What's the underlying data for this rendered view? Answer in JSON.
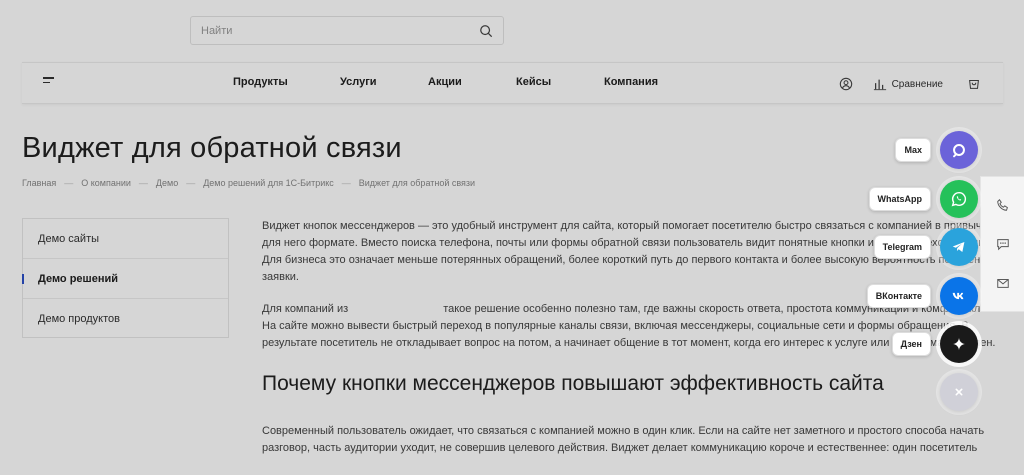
{
  "search": {
    "placeholder": "Найти"
  },
  "nav": {
    "items": [
      "Продукты",
      "Услуги",
      "Акции",
      "Кейсы",
      "Компания"
    ],
    "compare_label": "Сравнение"
  },
  "page": {
    "title": "Виджет для обратной связи",
    "breadcrumb": [
      "Главная",
      "О компании",
      "Демо",
      "Демо решений для 1С-Битрикс",
      "Виджет для обратной связи"
    ]
  },
  "sidemenu": {
    "items": [
      "Демо сайты",
      "Демо решений",
      "Демо продуктов"
    ],
    "active_index": 1
  },
  "article": {
    "p1": "Виджет кнопок мессенджеров — это удобный инструмент для сайта, который помогает посетителю быстро связаться с компанией в привычном для него формате. Вместо поиска телефона, почты или формы обратной связи пользователь видит понятные кнопки и сразу переходит к диалогу. Для бизнеса это означает меньше потерянных обращений, более короткий путь до первого контакта и более высокую вероятность получения заявки.",
    "p2_start": "Для компаний из",
    "p2_rest": "такое решение особенно полезно там, где важны скорость ответа, простота коммуникации и комфорт клиента. На сайте можно вывести быстрый переход в популярные каналы связи, включая мессенджеры, социальные сети и формы обращения. В результате посетитель не откладывает вопрос на потом, а начинает общение в тот момент, когда его интерес к услуге или товару максимален.",
    "h2": "Почему кнопки мессенджеров повышают эффективность сайта",
    "p3": "Современный пользователь ожидает, что связаться с компанией можно в один клик. Если на сайте нет заметного и простого способа начать разговор, часть аудитории уходит, не совершив целевого действия. Виджет делает коммуникацию короче и естественнее: один посетитель"
  },
  "widget": {
    "buttons": [
      {
        "label": "Max",
        "color": "#6b63d9"
      },
      {
        "label": "WhatsApp",
        "color": "#25c15a"
      },
      {
        "label": "Telegram",
        "color": "#2aa3dc"
      },
      {
        "label": "ВКонтакте",
        "color": "#0a74e8"
      },
      {
        "label": "Дзен",
        "color": "#1a1a1a"
      }
    ],
    "close_color": "#d0d0d8"
  }
}
